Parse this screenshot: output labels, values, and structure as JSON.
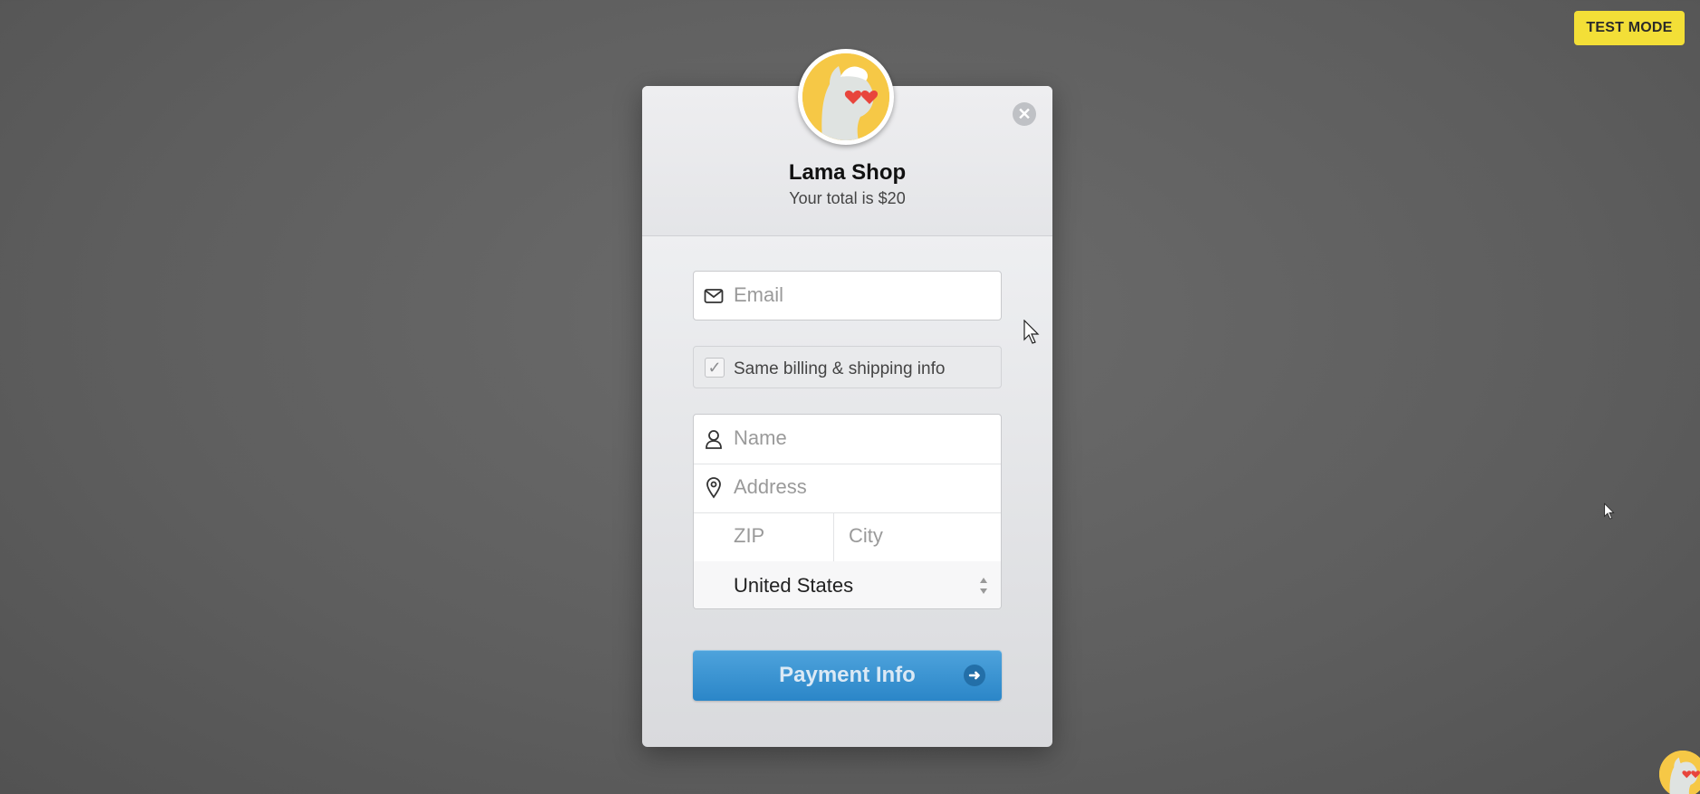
{
  "badge": {
    "label": "TEST MODE"
  },
  "checkout": {
    "shop_name": "Lama Shop",
    "total_text": "Your total is $20",
    "logo_icon": "llama-heart-eyes-icon",
    "close_icon": "close-icon"
  },
  "form": {
    "email": {
      "placeholder": "Email",
      "icon": "envelope-icon"
    },
    "same_info": {
      "label": "Same billing & shipping info",
      "checked": true
    },
    "name": {
      "placeholder": "Name",
      "icon": "user-icon"
    },
    "address": {
      "placeholder": "Address",
      "icon": "map-pin-icon"
    },
    "zip": {
      "placeholder": "ZIP"
    },
    "city": {
      "placeholder": "City"
    },
    "country": {
      "value": "United States"
    }
  },
  "submit": {
    "label": "Payment Info",
    "icon": "arrow-right-icon"
  },
  "colors": {
    "badge": "#f3df37",
    "button": "#2b86c8",
    "background": "#606060",
    "logo_bg": "#f6c846"
  }
}
